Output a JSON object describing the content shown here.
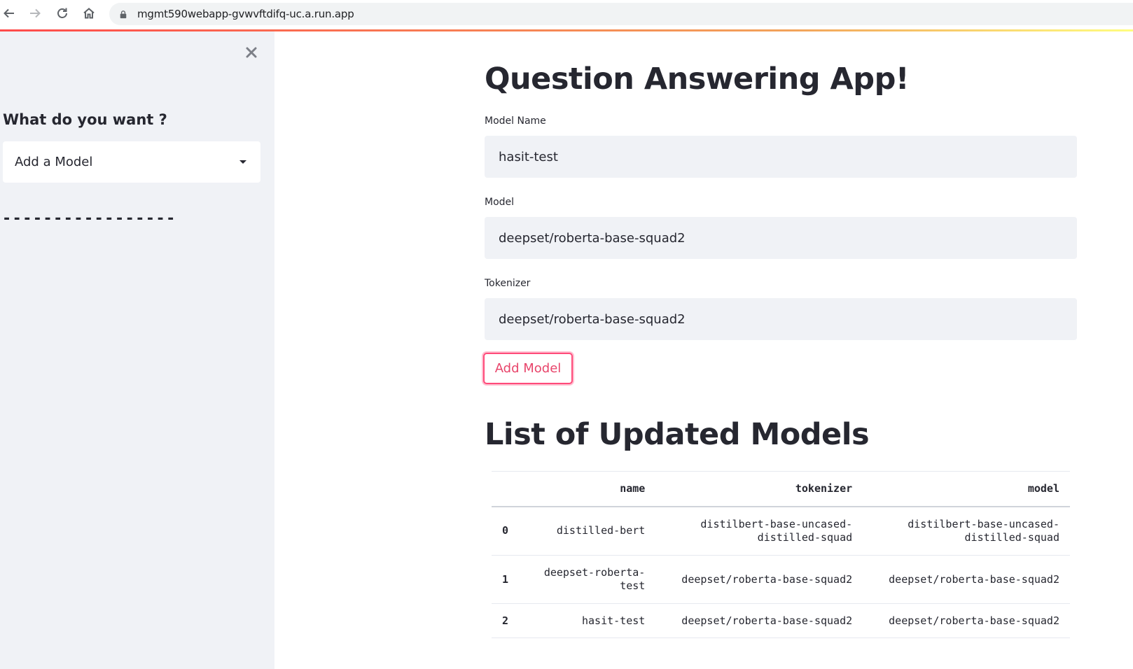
{
  "browser": {
    "url": "mgmt590webapp-gvwvftdifq-uc.a.run.app"
  },
  "sidebar": {
    "title": "What do you want ?",
    "select_value": "Add a Model",
    "divider": "-----------------"
  },
  "main": {
    "title": "Question Answering App!",
    "fields": [
      {
        "label": "Model Name",
        "value": "hasit-test"
      },
      {
        "label": "Model",
        "value": "deepset/roberta-base-squad2"
      },
      {
        "label": "Tokenizer",
        "value": "deepset/roberta-base-squad2"
      }
    ],
    "add_button_label": "Add Model",
    "table_title": "List of Updated Models",
    "table": {
      "columns": [
        "",
        "name",
        "tokenizer",
        "model"
      ],
      "rows": [
        {
          "index": "0",
          "name": "distilled-bert",
          "tokenizer": "distilbert-base-uncased-distilled-squad",
          "model": "distilbert-base-uncased-distilled-squad"
        },
        {
          "index": "1",
          "name": "deepset-roberta-test",
          "tokenizer": "deepset/roberta-base-squad2",
          "model": "deepset/roberta-base-squad2"
        },
        {
          "index": "2",
          "name": "hasit-test",
          "tokenizer": "deepset/roberta-base-squad2",
          "model": "deepset/roberta-base-squad2"
        }
      ]
    }
  },
  "colors": {
    "primary": "#ff4b4b",
    "button_text": "#e8456b",
    "sidebar_bg": "#f0f2f6",
    "input_bg": "#f0f2f6",
    "text": "#262730"
  },
  "icons": {
    "back": "arrow-left-icon",
    "forward": "arrow-right-icon",
    "reload": "reload-icon",
    "home": "home-icon",
    "lock": "lock-icon",
    "close": "close-icon",
    "caret": "caret-down-icon"
  }
}
